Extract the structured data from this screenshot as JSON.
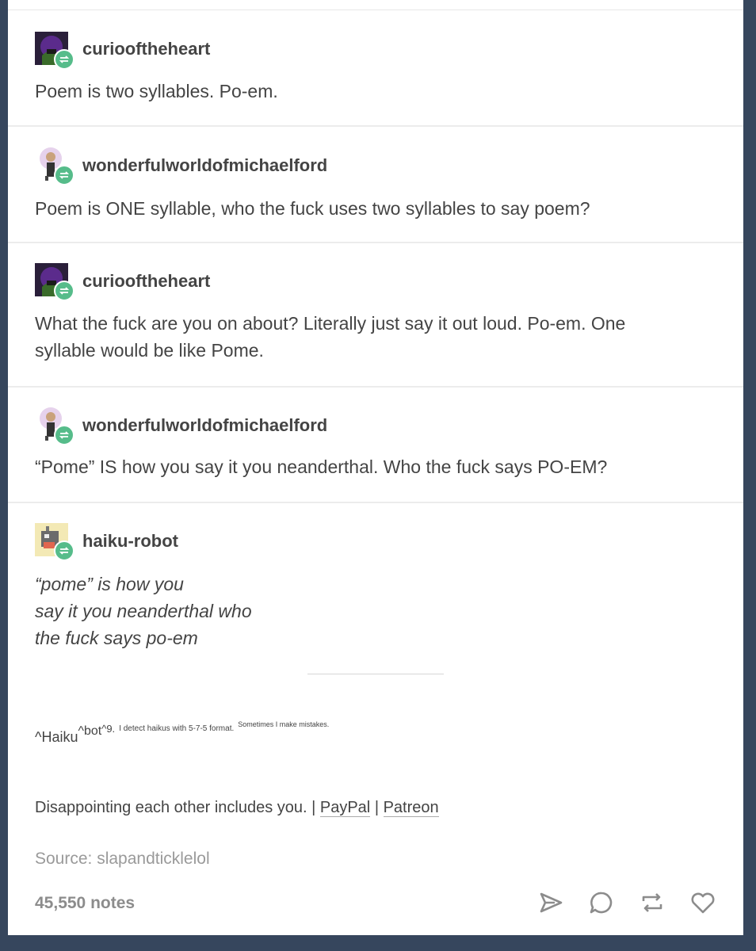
{
  "thread": [
    {
      "username": "curiooftheheart",
      "text": "Poem is two syllables. Po-em.",
      "avatar_icon": "purple-hood-avatar"
    },
    {
      "username": "wonderfulworldofmichaelford",
      "text": "Poem is ONE syllable, who the fuck uses two syllables to say poem?",
      "avatar_icon": "figure-avatar"
    },
    {
      "username": "curiooftheheart",
      "text_line1": "What the fuck are you on about? Literally just say it out loud. Po-em. One",
      "text_line2": "syllable would be like Pome.",
      "avatar_icon": "purple-hood-avatar"
    },
    {
      "username": "wonderfulworldofmichaelford",
      "text": "“Pome” IS how you say it you neanderthal. Who the fuck says PO-EM?",
      "avatar_icon": "figure-avatar"
    },
    {
      "username": "haiku-robot",
      "avatar_icon": "robot-avatar",
      "haiku": [
        "“pome” is how you",
        "say it you neanderthal who",
        "the fuck says po-em"
      ]
    }
  ],
  "bot_footer": {
    "part1": "^Haiku",
    "part2": "^bot",
    "part3": "^9.",
    "part4": "I detect haikus with 5-7-5 format.",
    "part5": "Sometimes I make mistakes."
  },
  "disappoint": {
    "text": "Disappointing each other includes you. |",
    "sep": "|",
    "paypal": "PayPal",
    "patreon": "Patreon"
  },
  "source": "Source: slapandticklelol",
  "notes": "45,550 notes",
  "colors": {
    "background": "#36465d",
    "reblog_green": "#56bc8a",
    "card": "#ffffff"
  },
  "actions": [
    "share-icon",
    "comment-icon",
    "reblog-icon",
    "heart-icon"
  ]
}
